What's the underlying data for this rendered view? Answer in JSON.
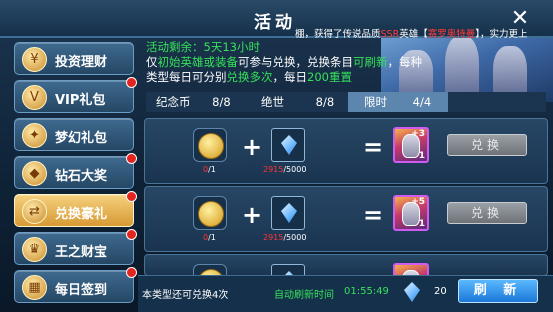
{
  "header": {
    "title": "活动",
    "ticker_prefix": "棚，获得了传说品质",
    "ticker_red1": "SSR",
    "ticker_mid": "英雄【",
    "ticker_red2": "赛罗奥特曼",
    "ticker_suffix": "】，实力更上"
  },
  "sidebar": {
    "items": [
      {
        "label": "投资理财",
        "icon": "coin-icon",
        "badge": false,
        "active": false
      },
      {
        "label": "VIP礼包",
        "icon": "vip-icon",
        "badge": true,
        "active": false
      },
      {
        "label": "梦幻礼包",
        "icon": "gift-icon",
        "badge": false,
        "active": false
      },
      {
        "label": "钻石大奖",
        "icon": "diamond-icon",
        "badge": true,
        "active": false
      },
      {
        "label": "兑换豪礼",
        "icon": "exchange-icon",
        "badge": true,
        "active": true
      },
      {
        "label": "王之财宝",
        "icon": "treasure-icon",
        "badge": true,
        "active": false
      },
      {
        "label": "每日签到",
        "icon": "calendar-icon",
        "badge": true,
        "active": false
      }
    ]
  },
  "info": {
    "remaining_label": "活动剩余：",
    "remaining_time": "5天13小时",
    "line2_a": "仅",
    "line2_b": "初始英雄或装备",
    "line2_c": "可参与兑换，兑换条目",
    "line2_d": "可刷新",
    "line2_e": "，每种",
    "line3_a": "类型每日可分别",
    "line3_b": "兑换多次",
    "line3_c": "，每日",
    "line3_d": "200重置"
  },
  "tabs": [
    {
      "name": "纪念币",
      "count": "8/8",
      "selected": false
    },
    {
      "name": "绝世",
      "count": "8/8",
      "selected": false
    },
    {
      "name": "限时",
      "count": "4/4",
      "selected": true
    }
  ],
  "rows": [
    {
      "coin_have": "0",
      "coin_need": "/1",
      "gem_have": "2915",
      "gem_need": "/5000",
      "hero_level": "+3",
      "hero_qty": "1",
      "button": "兑换"
    },
    {
      "coin_have": "0",
      "coin_need": "/1",
      "gem_have": "2915",
      "gem_need": "/5000",
      "hero_level": "+5",
      "hero_qty": "1",
      "button": "兑换"
    }
  ],
  "symbols": {
    "plus": "+",
    "equals": "="
  },
  "bottom": {
    "remaining_text": "本类型还可兑换4次",
    "auto_refresh_label": "自动刷新时间",
    "auto_refresh_time": "01:55:49",
    "gem_count": "20",
    "refresh_button": "刷 新"
  },
  "colors": {
    "accent_green": "#36e15a",
    "red": "#ff3232",
    "gold": "#d79a34",
    "blue": "#1b78d8"
  }
}
